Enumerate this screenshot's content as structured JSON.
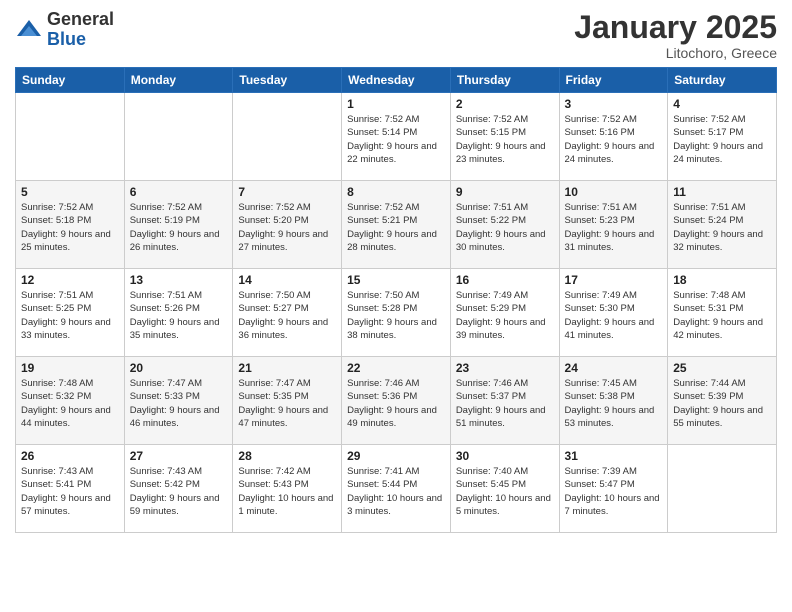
{
  "logo": {
    "general": "General",
    "blue": "Blue"
  },
  "header": {
    "month": "January 2025",
    "location": "Litochoro, Greece"
  },
  "days_of_week": [
    "Sunday",
    "Monday",
    "Tuesday",
    "Wednesday",
    "Thursday",
    "Friday",
    "Saturday"
  ],
  "weeks": [
    [
      {
        "day": "",
        "info": ""
      },
      {
        "day": "",
        "info": ""
      },
      {
        "day": "",
        "info": ""
      },
      {
        "day": "1",
        "sunrise": "Sunrise: 7:52 AM",
        "sunset": "Sunset: 5:14 PM",
        "daylight": "Daylight: 9 hours and 22 minutes."
      },
      {
        "day": "2",
        "sunrise": "Sunrise: 7:52 AM",
        "sunset": "Sunset: 5:15 PM",
        "daylight": "Daylight: 9 hours and 23 minutes."
      },
      {
        "day": "3",
        "sunrise": "Sunrise: 7:52 AM",
        "sunset": "Sunset: 5:16 PM",
        "daylight": "Daylight: 9 hours and 24 minutes."
      },
      {
        "day": "4",
        "sunrise": "Sunrise: 7:52 AM",
        "sunset": "Sunset: 5:17 PM",
        "daylight": "Daylight: 9 hours and 24 minutes."
      }
    ],
    [
      {
        "day": "5",
        "sunrise": "Sunrise: 7:52 AM",
        "sunset": "Sunset: 5:18 PM",
        "daylight": "Daylight: 9 hours and 25 minutes."
      },
      {
        "day": "6",
        "sunrise": "Sunrise: 7:52 AM",
        "sunset": "Sunset: 5:19 PM",
        "daylight": "Daylight: 9 hours and 26 minutes."
      },
      {
        "day": "7",
        "sunrise": "Sunrise: 7:52 AM",
        "sunset": "Sunset: 5:20 PM",
        "daylight": "Daylight: 9 hours and 27 minutes."
      },
      {
        "day": "8",
        "sunrise": "Sunrise: 7:52 AM",
        "sunset": "Sunset: 5:21 PM",
        "daylight": "Daylight: 9 hours and 28 minutes."
      },
      {
        "day": "9",
        "sunrise": "Sunrise: 7:51 AM",
        "sunset": "Sunset: 5:22 PM",
        "daylight": "Daylight: 9 hours and 30 minutes."
      },
      {
        "day": "10",
        "sunrise": "Sunrise: 7:51 AM",
        "sunset": "Sunset: 5:23 PM",
        "daylight": "Daylight: 9 hours and 31 minutes."
      },
      {
        "day": "11",
        "sunrise": "Sunrise: 7:51 AM",
        "sunset": "Sunset: 5:24 PM",
        "daylight": "Daylight: 9 hours and 32 minutes."
      }
    ],
    [
      {
        "day": "12",
        "sunrise": "Sunrise: 7:51 AM",
        "sunset": "Sunset: 5:25 PM",
        "daylight": "Daylight: 9 hours and 33 minutes."
      },
      {
        "day": "13",
        "sunrise": "Sunrise: 7:51 AM",
        "sunset": "Sunset: 5:26 PM",
        "daylight": "Daylight: 9 hours and 35 minutes."
      },
      {
        "day": "14",
        "sunrise": "Sunrise: 7:50 AM",
        "sunset": "Sunset: 5:27 PM",
        "daylight": "Daylight: 9 hours and 36 minutes."
      },
      {
        "day": "15",
        "sunrise": "Sunrise: 7:50 AM",
        "sunset": "Sunset: 5:28 PM",
        "daylight": "Daylight: 9 hours and 38 minutes."
      },
      {
        "day": "16",
        "sunrise": "Sunrise: 7:49 AM",
        "sunset": "Sunset: 5:29 PM",
        "daylight": "Daylight: 9 hours and 39 minutes."
      },
      {
        "day": "17",
        "sunrise": "Sunrise: 7:49 AM",
        "sunset": "Sunset: 5:30 PM",
        "daylight": "Daylight: 9 hours and 41 minutes."
      },
      {
        "day": "18",
        "sunrise": "Sunrise: 7:48 AM",
        "sunset": "Sunset: 5:31 PM",
        "daylight": "Daylight: 9 hours and 42 minutes."
      }
    ],
    [
      {
        "day": "19",
        "sunrise": "Sunrise: 7:48 AM",
        "sunset": "Sunset: 5:32 PM",
        "daylight": "Daylight: 9 hours and 44 minutes."
      },
      {
        "day": "20",
        "sunrise": "Sunrise: 7:47 AM",
        "sunset": "Sunset: 5:33 PM",
        "daylight": "Daylight: 9 hours and 46 minutes."
      },
      {
        "day": "21",
        "sunrise": "Sunrise: 7:47 AM",
        "sunset": "Sunset: 5:35 PM",
        "daylight": "Daylight: 9 hours and 47 minutes."
      },
      {
        "day": "22",
        "sunrise": "Sunrise: 7:46 AM",
        "sunset": "Sunset: 5:36 PM",
        "daylight": "Daylight: 9 hours and 49 minutes."
      },
      {
        "day": "23",
        "sunrise": "Sunrise: 7:46 AM",
        "sunset": "Sunset: 5:37 PM",
        "daylight": "Daylight: 9 hours and 51 minutes."
      },
      {
        "day": "24",
        "sunrise": "Sunrise: 7:45 AM",
        "sunset": "Sunset: 5:38 PM",
        "daylight": "Daylight: 9 hours and 53 minutes."
      },
      {
        "day": "25",
        "sunrise": "Sunrise: 7:44 AM",
        "sunset": "Sunset: 5:39 PM",
        "daylight": "Daylight: 9 hours and 55 minutes."
      }
    ],
    [
      {
        "day": "26",
        "sunrise": "Sunrise: 7:43 AM",
        "sunset": "Sunset: 5:41 PM",
        "daylight": "Daylight: 9 hours and 57 minutes."
      },
      {
        "day": "27",
        "sunrise": "Sunrise: 7:43 AM",
        "sunset": "Sunset: 5:42 PM",
        "daylight": "Daylight: 9 hours and 59 minutes."
      },
      {
        "day": "28",
        "sunrise": "Sunrise: 7:42 AM",
        "sunset": "Sunset: 5:43 PM",
        "daylight": "Daylight: 10 hours and 1 minute."
      },
      {
        "day": "29",
        "sunrise": "Sunrise: 7:41 AM",
        "sunset": "Sunset: 5:44 PM",
        "daylight": "Daylight: 10 hours and 3 minutes."
      },
      {
        "day": "30",
        "sunrise": "Sunrise: 7:40 AM",
        "sunset": "Sunset: 5:45 PM",
        "daylight": "Daylight: 10 hours and 5 minutes."
      },
      {
        "day": "31",
        "sunrise": "Sunrise: 7:39 AM",
        "sunset": "Sunset: 5:47 PM",
        "daylight": "Daylight: 10 hours and 7 minutes."
      },
      {
        "day": "",
        "info": ""
      }
    ]
  ]
}
